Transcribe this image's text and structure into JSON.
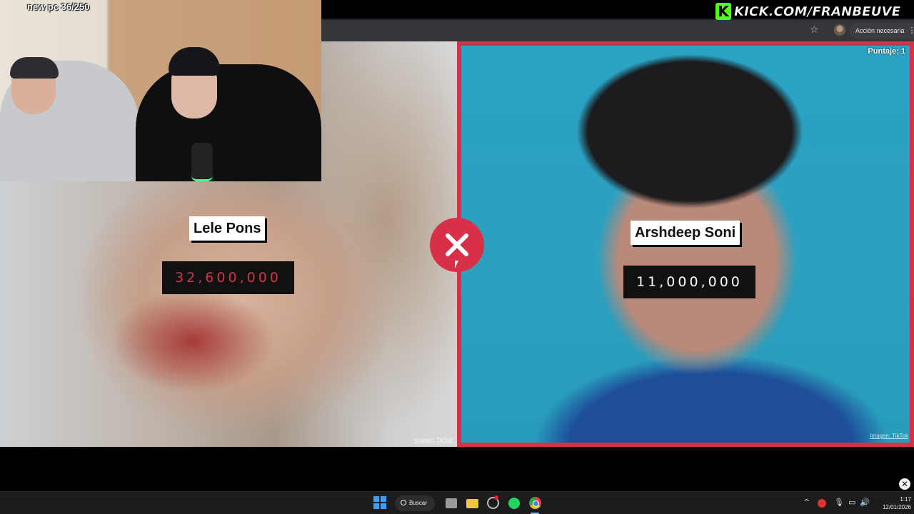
{
  "browser": {
    "action_label": "Acción necesaria",
    "kebab": "⋮",
    "star": "☆"
  },
  "kick": {
    "logo": "K",
    "url": "KICK.COM/FRANBEUVE",
    "color": "#53fc18"
  },
  "webcam": {
    "caption": "new pc 36/250"
  },
  "game": {
    "score_label": "Puntaje: 1",
    "left": {
      "name": "Lele Pons",
      "value": "32,600,000",
      "credit": "Imagen: TikTok"
    },
    "right": {
      "name": "Arshdeep Soni",
      "value": "11,000,000",
      "credit": "Imagen: TikTok"
    },
    "result_icon": "x-icon",
    "accent_color": "#d9304a"
  },
  "overlay": {
    "close": "✕"
  },
  "taskbar": {
    "search_label": "Buscar",
    "tray": {
      "chevron": "^",
      "mic": "🎙",
      "net": "▭",
      "vol": "🔊"
    },
    "clock": {
      "time": "1:17",
      "date": "12/01/2026"
    }
  }
}
